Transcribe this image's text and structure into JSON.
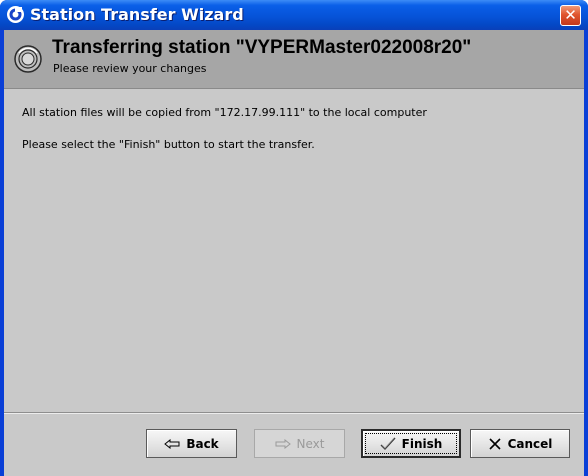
{
  "window": {
    "title": "Station Transfer Wizard"
  },
  "header": {
    "title": "Transferring station \"VYPERMaster022008r20\"",
    "subtitle": "Please review your changes"
  },
  "body": {
    "line1": "All station files will be copied from \"172.17.99.111\" to the local computer",
    "line2": "Please select the \"Finish\" button to start the transfer."
  },
  "buttons": {
    "back": "Back",
    "next": "Next",
    "finish": "Finish",
    "cancel": "Cancel"
  },
  "icons": {
    "app": "app-logo-icon",
    "close": "close-icon",
    "header": "transfer-disc-icon",
    "back": "left-arrow-icon",
    "next": "right-arrow-icon",
    "finish": "checkmark-icon",
    "cancel": "x-icon"
  }
}
